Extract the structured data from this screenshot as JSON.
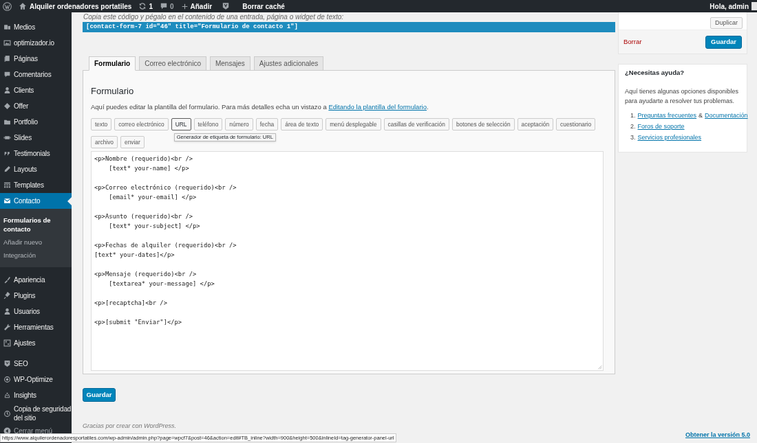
{
  "admin_bar": {
    "site_name": "Alquiler ordenadores portatiles",
    "updates": "1",
    "comments": "0",
    "new_label": "Añadir",
    "cache_label": "Borrar caché",
    "greeting": "Hola, admin"
  },
  "sidebar": {
    "groups": [
      [
        {
          "label": "Medios",
          "selected": false
        },
        {
          "label": "optimizador.io",
          "selected": false
        },
        {
          "label": "Páginas",
          "selected": false
        },
        {
          "label": "Comentarios",
          "selected": false
        },
        {
          "label": "Clients",
          "selected": false
        },
        {
          "label": "Offer",
          "selected": false
        },
        {
          "label": "Portfolio",
          "selected": false
        },
        {
          "label": "Slides",
          "selected": false
        },
        {
          "label": "Testimonials",
          "selected": false
        },
        {
          "label": "Layouts",
          "selected": false
        },
        {
          "label": "Templates",
          "selected": false
        },
        {
          "label": "Contacto",
          "selected": true,
          "children": [
            {
              "label": "Formularios de contacto",
              "selected": true
            },
            {
              "label": "Añadir nuevo",
              "selected": false
            },
            {
              "label": "Integración",
              "selected": false
            }
          ]
        },
        {
          "label": "Apariencia",
          "selected": false
        },
        {
          "label": "Plugins",
          "selected": false
        },
        {
          "label": "Usuarios",
          "selected": false
        },
        {
          "label": "Herramientas",
          "selected": false
        },
        {
          "label": "Ajustes",
          "selected": false
        }
      ],
      [
        {
          "label": "SEO",
          "selected": false
        },
        {
          "label": "WP-Optimize",
          "selected": false
        },
        {
          "label": "Insights",
          "selected": false
        },
        {
          "label": "Copia de seguridad del sitio",
          "selected": false
        }
      ]
    ],
    "collapse_label": "Cerrar menú"
  },
  "shortcode": {
    "hint": "Copia este código y pégalo en el contenido de una entrada, página o widget de texto:",
    "code": "[contact-form-7 id=\"46\" title=\"Formulario de contacto 1\"]"
  },
  "tabs": [
    {
      "label": "Formulario",
      "selected": true
    },
    {
      "label": "Correo electrónico",
      "selected": false
    },
    {
      "label": "Mensajes",
      "selected": false
    },
    {
      "label": "Ajustes adicionales",
      "selected": false
    }
  ],
  "form_panel": {
    "title": "Formulario",
    "description": "Aquí puedes editar la plantilla del formulario. Para más detalles echa un vistazo a ",
    "link": "Editando la plantilla del formulario",
    "after_link": ".",
    "tag_buttons": [
      {
        "label": "texto",
        "focused": false
      },
      {
        "label": "correo electrónico",
        "focused": false
      },
      {
        "label": "URL",
        "focused": true
      },
      {
        "label": "teléfono",
        "focused": false
      },
      {
        "label": "número",
        "focused": false
      },
      {
        "label": "fecha",
        "focused": false
      },
      {
        "label": "área de texto",
        "focused": false
      },
      {
        "label": "menú desplegable",
        "focused": false
      },
      {
        "label": "casillas de verificación",
        "focused": false
      },
      {
        "label": "botones de selección",
        "focused": false
      },
      {
        "label": "aceptación",
        "focused": false
      },
      {
        "label": "cuestionario",
        "focused": false
      },
      {
        "label": "archivo",
        "focused": false
      },
      {
        "label": "enviar",
        "focused": false
      }
    ],
    "tooltip": "Generador de etiqueta de formulario: URL",
    "template": "<p>Nombre (requerido)<br />\n    [text* your-name] </p>\n\n<p>Correo electrónico (requerido)<br />\n    [email* your-email] </p>\n\n<p>Asunto (requerido)<br />\n    [text* your-subject] </p>\n\n<p>Fechas de alquiler (requerido)<br />\n[text* your-dates]</p>\n\n<p>Mensaje (requerido)<br />\n    [textarea* your-message] </p>\n\n<p>[recaptcha]<br />\n\n<p>[submit \"Enviar\"]</p>"
  },
  "save_button": "Guardar",
  "side_box": {
    "duplicate": "Duplicar",
    "delete": "Borrar",
    "save": "Guardar"
  },
  "help_box": {
    "title": "¿Necesitas ayuda?",
    "text": "Aquí tienes algunas opciones disponibles para ayudarte a resolver tus problemas.",
    "items": [
      {
        "number": "1.",
        "links": [
          "Preguntas frecuentes",
          "Documentación"
        ],
        "joiner": "&"
      },
      {
        "number": "2.",
        "links": [
          "Foros de soporte"
        ]
      },
      {
        "number": "3.",
        "links": [
          "Servicios profesionales"
        ]
      }
    ]
  },
  "footer": {
    "thanks": "Gracias por crear con WordPress.",
    "version_link": "Obtener la versión 5.0"
  },
  "status_url": "https://www.alquilerordenadoresportatiles.com/wp-admin/admin.php?page=wpcf7&post=46&action=edit#TB_inline?width=900&height=500&inlineId=tag-generator-panel-url"
}
